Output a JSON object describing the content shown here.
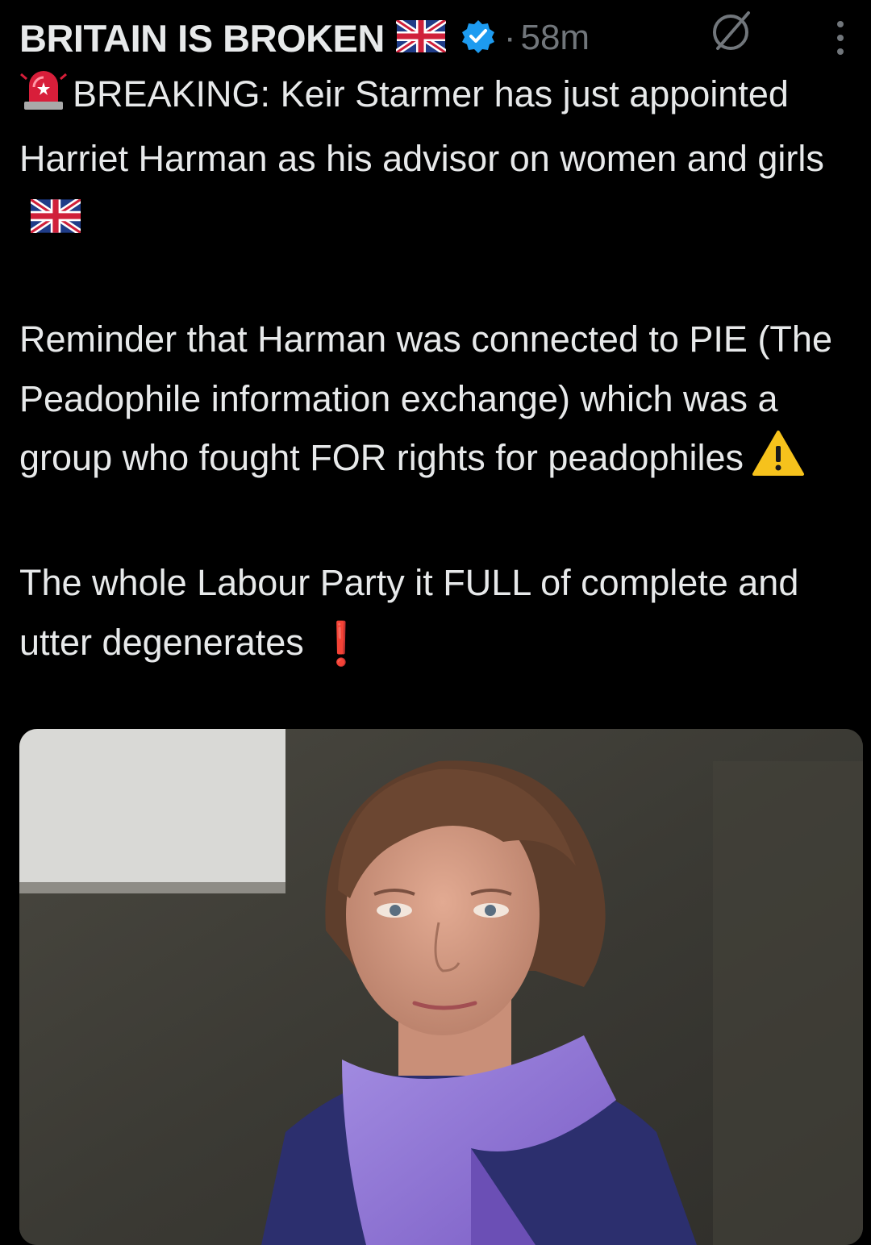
{
  "tweet": {
    "author_name": "BRITAIN IS BROKEN",
    "separator": "·",
    "time": "58m",
    "icons": {
      "flag": "uk-flag-icon",
      "verified": "verified-badge-icon",
      "grok": "grok-icon",
      "more": "more-options-icon",
      "siren": "siren-icon",
      "warning": "warning-icon",
      "exclamation": "red-exclamation-icon"
    },
    "paragraph1": "BREAKING: Keir Starmer has just appointed Harriet Harman as his advisor on women and girls",
    "paragraph2": "Reminder that Harman was connected to PIE (The Peadophile information exchange) which was a group who fought FOR rights for peadophiles",
    "paragraph3": "The whole Labour Party it FULL of complete and utter degenerates",
    "exclamation_glyph": "❗"
  },
  "colors": {
    "background": "#000000",
    "text": "#e7e9ea",
    "muted": "#71767b",
    "verified_blue": "#1d9bf0",
    "scarf_purple": "#8a6fd0",
    "coat_navy": "#2c2f6e"
  }
}
